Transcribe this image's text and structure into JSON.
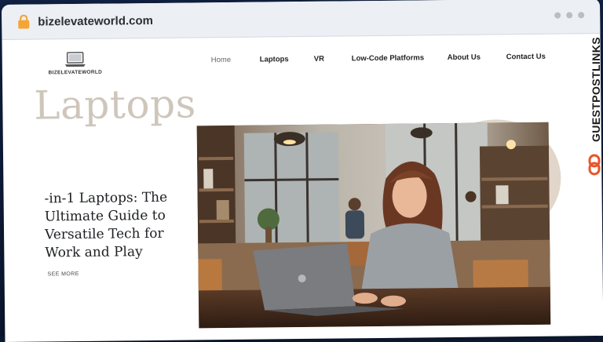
{
  "browser": {
    "url": "bizelevateworld.com"
  },
  "site": {
    "logo_text": "BIZELEVATEWORLD",
    "nav": {
      "home": "Home",
      "laptops": "Laptops",
      "vr": "VR",
      "low_code": "Low-Code Platforms",
      "about": "About Us",
      "contact": "Contact Us"
    },
    "hero_word": "Laptops",
    "headline": "-in-1 Laptops: The Ultimate Guide to Versatile Tech for Work and Play",
    "see_more": "SEE MORE"
  },
  "overlay": {
    "brand": "GUESTPOSTLINKS"
  },
  "colors": {
    "accent_beige": "#e1d6c9",
    "hero_word": "#cfc6bb",
    "brand_orange": "#e8552b"
  }
}
